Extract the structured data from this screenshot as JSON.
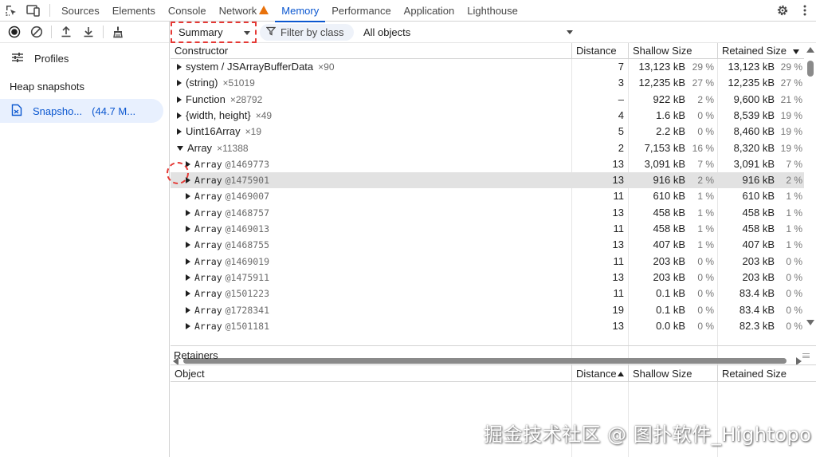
{
  "tabs": [
    {
      "label": "Sources"
    },
    {
      "label": "Elements"
    },
    {
      "label": "Console"
    },
    {
      "label": "Network"
    },
    {
      "label": "Memory"
    },
    {
      "label": "Performance"
    },
    {
      "label": "Application"
    },
    {
      "label": "Lighthouse"
    }
  ],
  "active_tab": "Memory",
  "accent_color": "#0b57d0",
  "highlight_color": "#e53935",
  "sidebar": {
    "profiles_label": "Profiles",
    "section_title": "Heap snapshots",
    "snapshot": {
      "label": "Snapsho...",
      "size": "(44.7 M..."
    }
  },
  "toolbar": {
    "view_select": "Summary",
    "filter_label": "Filter by class",
    "objects_select": "All objects"
  },
  "grid": {
    "columns": [
      "Constructor",
      "Distance",
      "Shallow Size",
      "Retained Size"
    ],
    "rows": [
      {
        "name": "system / JSArrayBufferData",
        "count": "×90",
        "distance": "7",
        "shallow": "13,123 kB",
        "shallow_pct": "29 %",
        "retained": "13,123 kB",
        "retained_pct": "29 %"
      },
      {
        "name": "(string)",
        "count": "×51019",
        "distance": "3",
        "shallow": "12,235 kB",
        "shallow_pct": "27 %",
        "retained": "12,235 kB",
        "retained_pct": "27 %"
      },
      {
        "name": "Function",
        "count": "×28792",
        "distance": "–",
        "shallow": "922 kB",
        "shallow_pct": "2 %",
        "retained": "9,600 kB",
        "retained_pct": "21 %"
      },
      {
        "name": "{width, height}",
        "count": "×49",
        "distance": "4",
        "shallow": "1.6 kB",
        "shallow_pct": "0 %",
        "retained": "8,539 kB",
        "retained_pct": "19 %"
      },
      {
        "name": "Uint16Array",
        "count": "×19",
        "distance": "5",
        "shallow": "2.2 kB",
        "shallow_pct": "0 %",
        "retained": "8,460 kB",
        "retained_pct": "19 %"
      },
      {
        "name": "Array",
        "count": "×11388",
        "distance": "2",
        "shallow": "7,153 kB",
        "shallow_pct": "16 %",
        "retained": "8,320 kB",
        "retained_pct": "19 %"
      },
      {
        "name": "Array",
        "id": "@1469773",
        "distance": "13",
        "shallow": "3,091 kB",
        "shallow_pct": "7 %",
        "retained": "3,091 kB",
        "retained_pct": "7 %"
      },
      {
        "name": "Array",
        "id": "@1475901",
        "distance": "13",
        "shallow": "916 kB",
        "shallow_pct": "2 %",
        "retained": "916 kB",
        "retained_pct": "2 %"
      },
      {
        "name": "Array",
        "id": "@1469007",
        "distance": "11",
        "shallow": "610 kB",
        "shallow_pct": "1 %",
        "retained": "610 kB",
        "retained_pct": "1 %"
      },
      {
        "name": "Array",
        "id": "@1468757",
        "distance": "13",
        "shallow": "458 kB",
        "shallow_pct": "1 %",
        "retained": "458 kB",
        "retained_pct": "1 %"
      },
      {
        "name": "Array",
        "id": "@1469013",
        "distance": "11",
        "shallow": "458 kB",
        "shallow_pct": "1 %",
        "retained": "458 kB",
        "retained_pct": "1 %"
      },
      {
        "name": "Array",
        "id": "@1468755",
        "distance": "13",
        "shallow": "407 kB",
        "shallow_pct": "1 %",
        "retained": "407 kB",
        "retained_pct": "1 %"
      },
      {
        "name": "Array",
        "id": "@1469019",
        "distance": "11",
        "shallow": "203 kB",
        "shallow_pct": "0 %",
        "retained": "203 kB",
        "retained_pct": "0 %"
      },
      {
        "name": "Array",
        "id": "@1475911",
        "distance": "13",
        "shallow": "203 kB",
        "shallow_pct": "0 %",
        "retained": "203 kB",
        "retained_pct": "0 %"
      },
      {
        "name": "Array",
        "id": "@1501223",
        "distance": "11",
        "shallow": "0.1 kB",
        "shallow_pct": "0 %",
        "retained": "83.4 kB",
        "retained_pct": "0 %"
      },
      {
        "name": "Array",
        "id": "@1728341",
        "distance": "19",
        "shallow": "0.1 kB",
        "shallow_pct": "0 %",
        "retained": "83.4 kB",
        "retained_pct": "0 %"
      },
      {
        "name": "Array",
        "id": "@1501181",
        "distance": "13",
        "shallow": "0.0 kB",
        "shallow_pct": "0 %",
        "retained": "82.3 kB",
        "retained_pct": "0 %"
      }
    ]
  },
  "retainers": {
    "title": "Retainers",
    "columns": [
      "Object",
      "Distance",
      "Shallow Size",
      "Retained Size"
    ]
  },
  "watermark": "掘金技术社区 @ 图扑软件_Hightopo"
}
